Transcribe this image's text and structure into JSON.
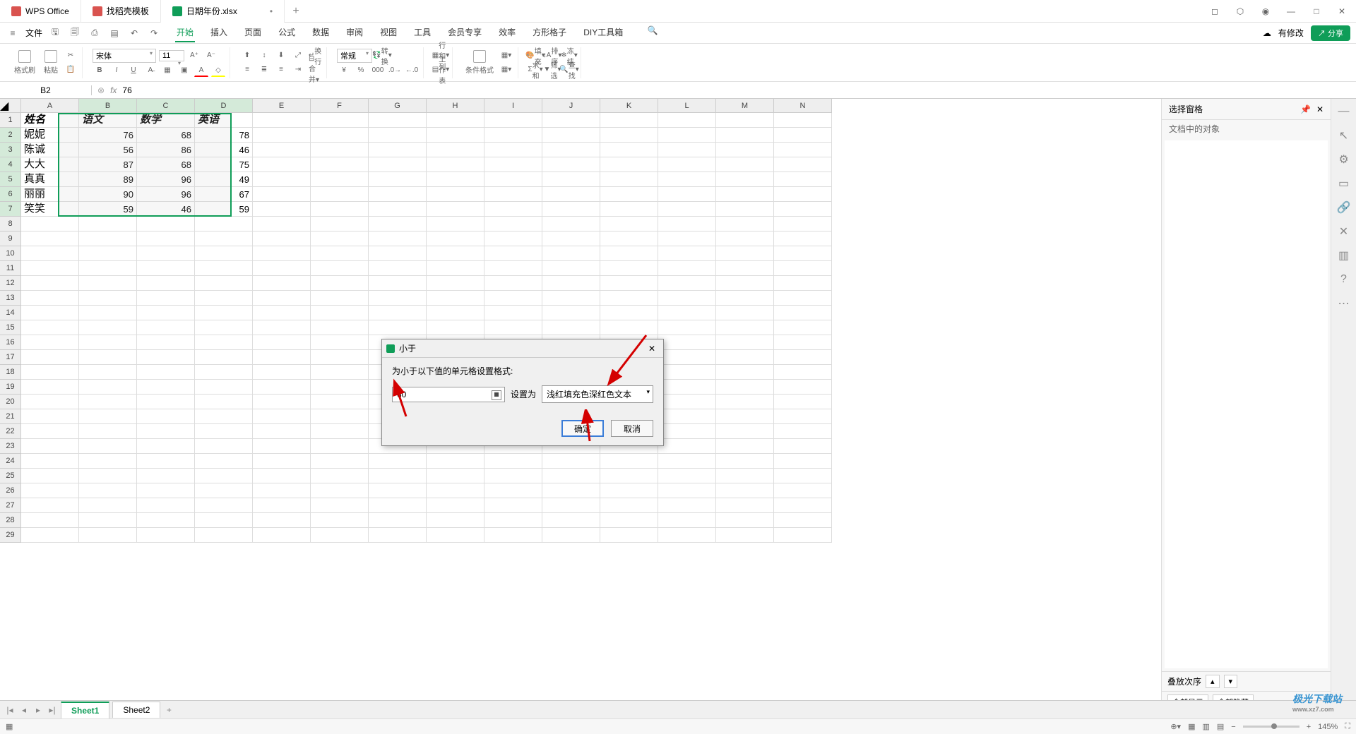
{
  "titlebar": {
    "tabs": [
      {
        "label": "WPS Office",
        "icon": "wps"
      },
      {
        "label": "找稻壳模板",
        "icon": "doc"
      },
      {
        "label": "日期年份.xlsx",
        "icon": "xls",
        "dirty": "•"
      }
    ],
    "add": "+"
  },
  "menubar": {
    "file": "文件",
    "tabs": [
      "开始",
      "插入",
      "页面",
      "公式",
      "数据",
      "审阅",
      "视图",
      "工具",
      "会员专享",
      "效率",
      "方形格子",
      "DIY工具箱"
    ],
    "active_index": 0,
    "modified": "有修改",
    "share": "分享"
  },
  "ribbon": {
    "format_painter": "格式刷",
    "paste": "粘贴",
    "font_name": "宋体",
    "font_size": "11",
    "wrap": "换行",
    "number_format": "常规",
    "transform": "转换",
    "rowcol": "行和列",
    "worksheet": "工作表",
    "cond_format": "条件格式",
    "fill": "填充",
    "sort": "排序",
    "freeze": "冻结",
    "sum": "求和",
    "filter": "筛选",
    "find": "查找"
  },
  "formulabar": {
    "cell_ref": "B2",
    "fx": "fx",
    "value": "76"
  },
  "grid": {
    "columns": [
      "A",
      "B",
      "C",
      "D",
      "E",
      "F",
      "G",
      "H",
      "I",
      "J",
      "K",
      "L",
      "M",
      "N"
    ],
    "row_count": 29,
    "headers": [
      "姓名",
      "语文",
      "数学",
      "英语"
    ],
    "data": [
      [
        "妮妮",
        "76",
        "68",
        "78"
      ],
      [
        "陈诚",
        "56",
        "86",
        "46"
      ],
      [
        "大大",
        "87",
        "68",
        "75"
      ],
      [
        "真真",
        "89",
        "96",
        "49"
      ],
      [
        "丽丽",
        "90",
        "96",
        "67"
      ],
      [
        "笑笑",
        "59",
        "46",
        "59"
      ]
    ]
  },
  "dialog": {
    "title": "小于",
    "label": "为小于以下值的单元格设置格式:",
    "value": "60",
    "set_as": "设置为",
    "format_option": "浅红填充色深红色文本",
    "ok": "确定",
    "cancel": "取消"
  },
  "right_panel": {
    "title": "选择窗格",
    "subtitle": "文档中的对象",
    "stack_order": "叠放次序",
    "show_all": "全部显示",
    "hide_all": "全部隐藏"
  },
  "sheet_tabs": {
    "sheets": [
      "Sheet1",
      "Sheet2"
    ],
    "add": "+"
  },
  "statusbar": {
    "zoom": "145%"
  },
  "watermark": {
    "main": "极光下载站",
    "sub": "www.xz7.com"
  }
}
